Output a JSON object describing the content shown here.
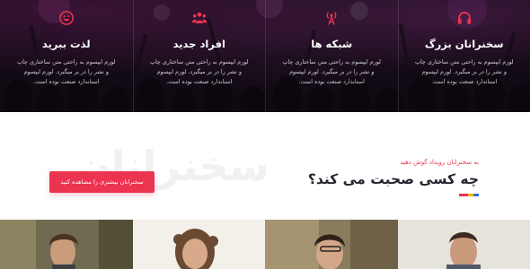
{
  "features": [
    {
      "icon": "headphones-icon",
      "title": "سخنرانان بزرگ",
      "description": "لورم ایپسوم به راحتی متن ساختاری چاپ و نشر را در بر میگیرد. لورم ایپسوم استاندارد صنعت بوده است."
    },
    {
      "icon": "broadcast-tower-icon",
      "title": "شبکه ها",
      "description": "لورم ایپسوم به راحتی متن ساختاری چاپ و نشر را در بر میگیرد. لورم ایپسوم استاندارد صنعت بوده است."
    },
    {
      "icon": "users-icon",
      "title": "افراد جدید",
      "description": "لورم ایپسوم به راحتی متن ساختاری چاپ و نشر را در بر میگیرد. لورم ایپسوم استاندارد صنعت بوده است."
    },
    {
      "icon": "smile-icon",
      "title": "لذت ببرید",
      "description": "لورم ایپسوم به راحتی متن ساختاری چاپ و نشر را در بر میگیرد. لورم ایپسوم استاندارد صنعت بوده است."
    }
  ],
  "speakers_section": {
    "watermark": "سخنرانان",
    "kicker": "به سخنرانان رویداد گوش دهید",
    "title": "چه کسی صحبت می کند؟",
    "cta_label": "سخنرانان بیشتری را مشاهده کنید"
  },
  "colors": {
    "accent": "#ec3450",
    "underline": [
      "#ec3450",
      "#f6b500",
      "#2f6fe4"
    ]
  }
}
